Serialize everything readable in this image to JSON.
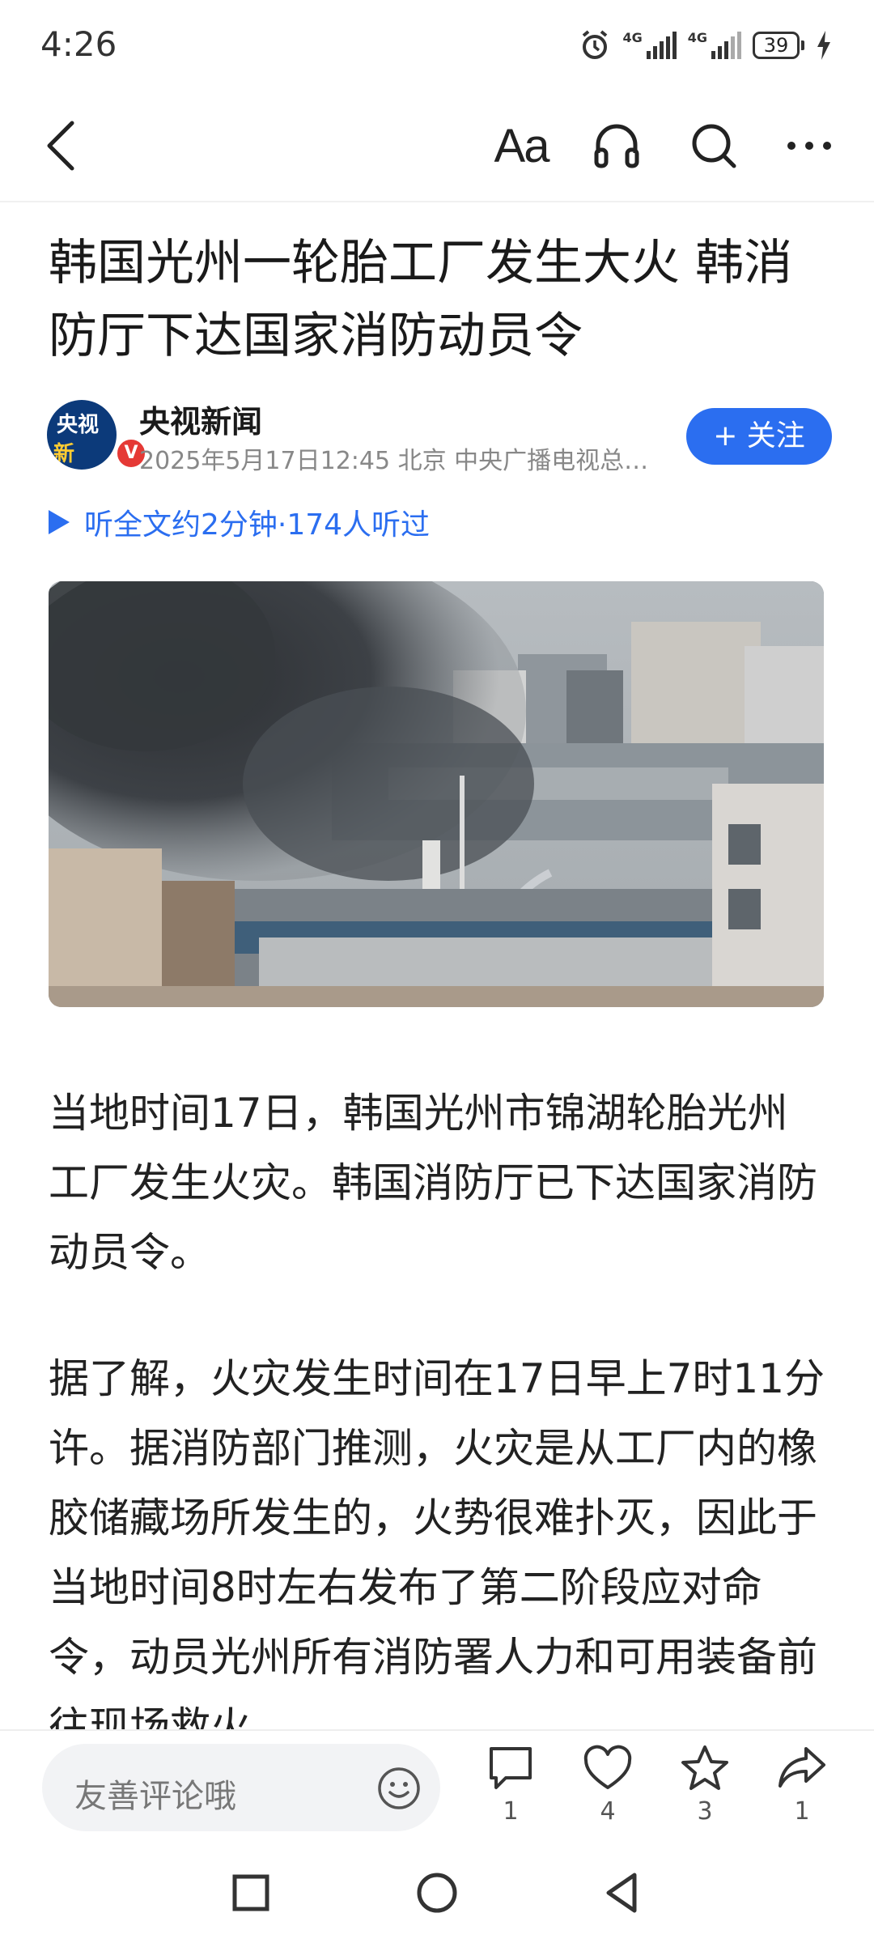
{
  "status_bar": {
    "time": "4:26",
    "network_1": "4G",
    "network_2": "4G",
    "battery_level": "39"
  },
  "top_nav": {
    "font_size_label": "Aa"
  },
  "article": {
    "title": "韩国光州一轮胎工厂发生大火 韩消防厅下达国家消防动员令",
    "author": {
      "name": "央视新闻",
      "avatar_text_1": "央视",
      "avatar_text_2": "新",
      "verified_badge": "V",
      "meta": "2025年5月17日12:45 北京 中央广播电视总…",
      "follow_label": "+ 关注"
    },
    "listen_label": "听全文约2分钟·174人听过",
    "paragraphs": [
      "当地时间17日，韩国光州市锦湖轮胎光州工厂发生火灾。韩国消防厅已下达国家消防动员令。",
      "据了解，火灾发生时间在17日早上7时11分许。据消防部门推测，火灾是从工厂内的橡胶储藏场所发生的，火势很难扑灭，因此于当地时间8时左右发布了第二阶段应对命令，动员光州所有消防署人力和可用装备前往现场救火。"
    ]
  },
  "action_bar": {
    "comment_placeholder": "友善评论哦",
    "comment_count": "1",
    "like_count": "4",
    "favorite_count": "3",
    "share_count": "1"
  },
  "colors": {
    "accent": "#2b6ef0",
    "text": "#1a1a1a",
    "meta": "#888888"
  }
}
